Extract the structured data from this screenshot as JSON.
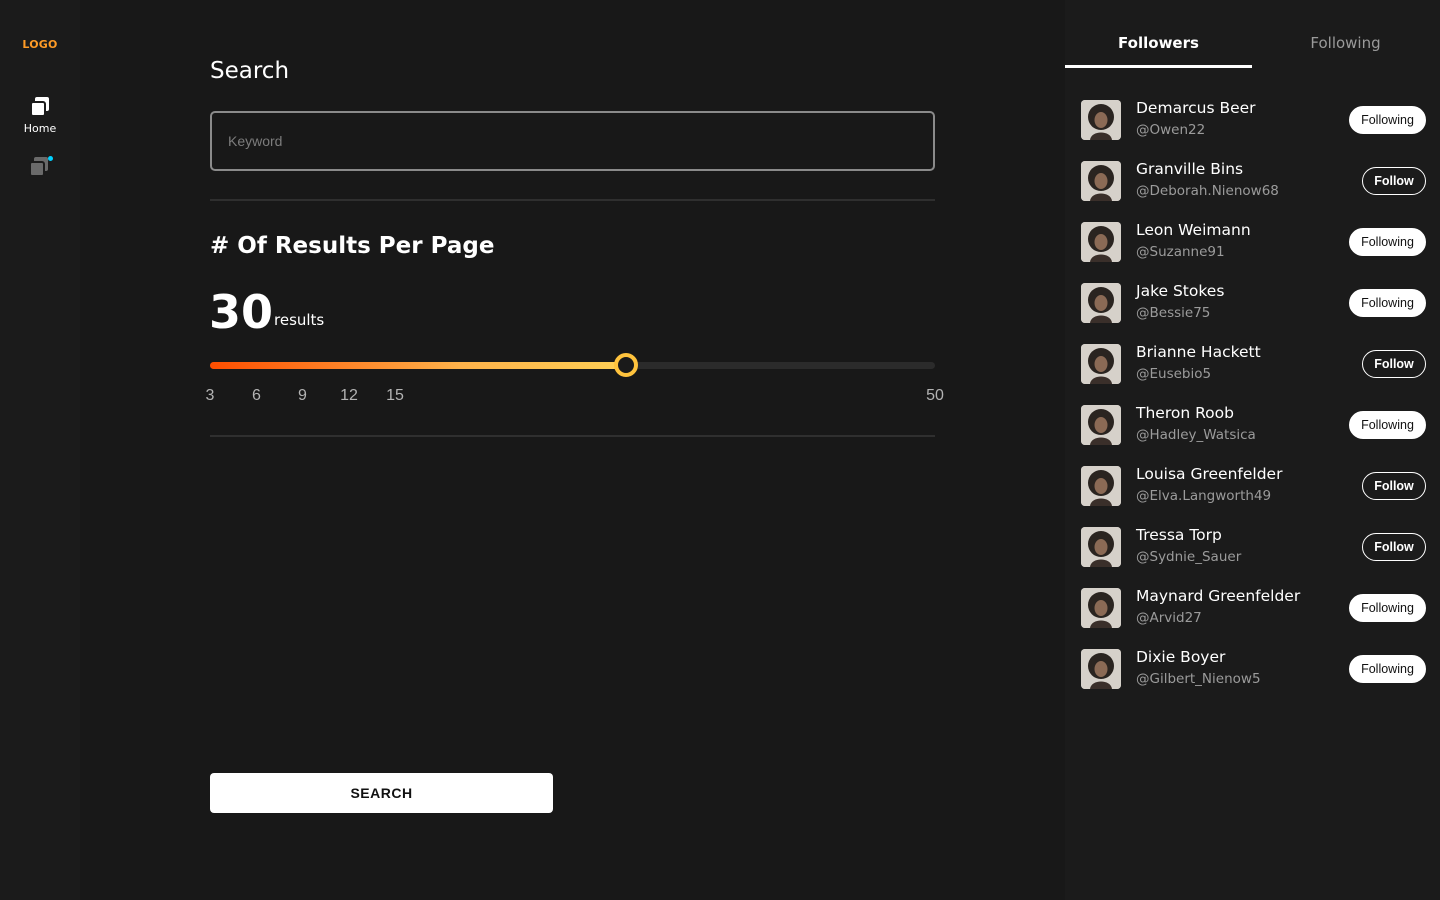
{
  "nav": {
    "logo": "LOGO",
    "home_label": "Home",
    "home_icon": "stacked-squares-icon",
    "second_icon": "stacked-squares-icon",
    "notification_color": "#00d1ff"
  },
  "main": {
    "title": "Search",
    "keyword_placeholder": "Keyword",
    "results_title": "# Of Results Per Page",
    "results_value": "30",
    "results_unit": "results",
    "slider": {
      "min": 3,
      "max": 50,
      "value": 30,
      "ticks": [
        "3",
        "6",
        "9",
        "12",
        "15",
        "50"
      ],
      "gradient_colors": [
        "#ff4e00",
        "#ffb24a",
        "#ffd055"
      ],
      "thumb_color": "#ffc33d"
    },
    "search_label": "SEARCH"
  },
  "panel": {
    "tabs": [
      {
        "label": "Followers",
        "active": true
      },
      {
        "label": "Following",
        "active": false
      }
    ],
    "users": [
      {
        "name": "Demarcus Beer",
        "handle": "@Owen22",
        "button": "Following"
      },
      {
        "name": "Granville Bins",
        "handle": "@Deborah.Nienow68",
        "button": "Follow"
      },
      {
        "name": "Leon Weimann",
        "handle": "@Suzanne91",
        "button": "Following"
      },
      {
        "name": "Jake Stokes",
        "handle": "@Bessie75",
        "button": "Following"
      },
      {
        "name": "Brianne Hackett",
        "handle": "@Eusebio5",
        "button": "Follow"
      },
      {
        "name": "Theron Roob",
        "handle": "@Hadley_Watsica",
        "button": "Following"
      },
      {
        "name": "Louisa Greenfelder",
        "handle": "@Elva.Langworth49",
        "button": "Follow"
      },
      {
        "name": "Tressa Torp",
        "handle": "@Sydnie_Sauer",
        "button": "Follow"
      },
      {
        "name": "Maynard Greenfelder",
        "handle": "@Arvid27",
        "button": "Following"
      },
      {
        "name": "Dixie Boyer",
        "handle": "@Gilbert_Nienow5",
        "button": "Following"
      }
    ]
  }
}
